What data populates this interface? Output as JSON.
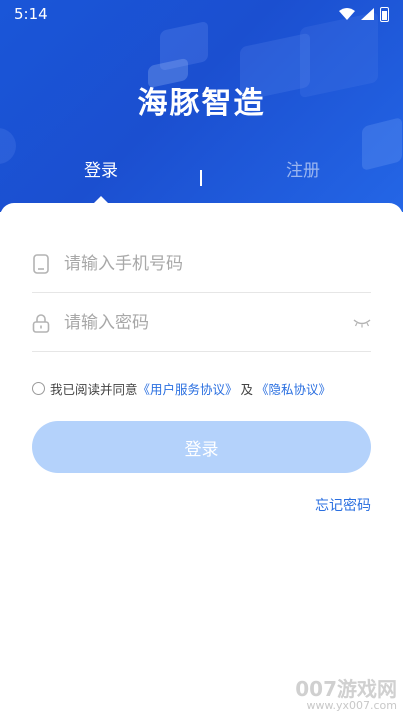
{
  "status_bar": {
    "time": "5:14",
    "icons": [
      "wifi-icon",
      "signal-icon",
      "battery-icon"
    ]
  },
  "app": {
    "logo_text": "海豚智造"
  },
  "tabs": [
    {
      "label": "登录",
      "active": true
    },
    {
      "label": "注册",
      "active": false
    }
  ],
  "form": {
    "phone": {
      "placeholder": "请输入手机号码",
      "value": "",
      "icon": "phone-icon"
    },
    "password": {
      "placeholder": "请输入密码",
      "value": "",
      "icon": "lock-icon",
      "toggle_icon": "eye-closed-icon"
    },
    "agreement": {
      "prefix": "我已阅读并同意",
      "user_agreement": "《用户服务协议》",
      "conjunction": "及",
      "privacy_policy": "《隐私协议》",
      "checked": false
    },
    "login_button": "登录",
    "forgot_password": "忘记密码"
  },
  "watermark": {
    "title": "007游戏网",
    "url": "www.yx007.com"
  },
  "colors": {
    "primary": "#1b4fd0",
    "link": "#2a6fe0",
    "button_disabled": "#b4d2fb"
  }
}
